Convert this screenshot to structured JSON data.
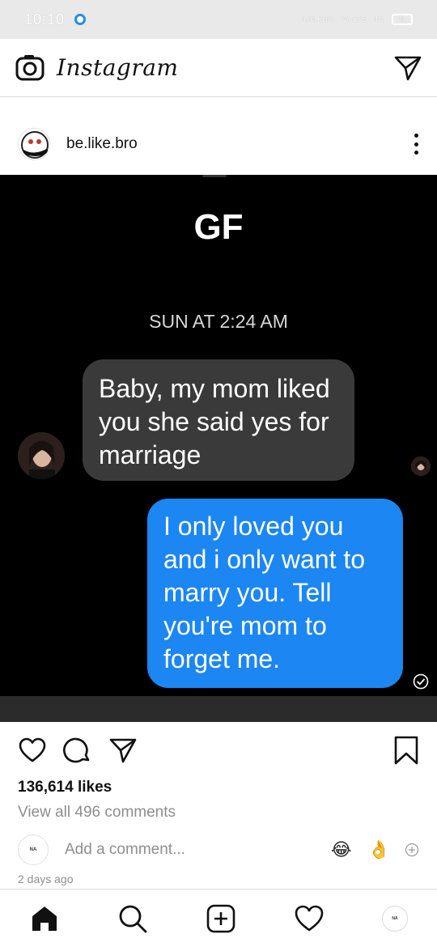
{
  "status_bar": {
    "time": "10:10",
    "speed": "3.00 KB/S",
    "network": "Vo LTE",
    "signal": "4G",
    "battery": "31"
  },
  "app_bar": {
    "brand": "Instagram",
    "camera_icon": "camera-icon",
    "direct_icon": "paper-plane-icon"
  },
  "post": {
    "username": "be.like.bro",
    "more_icon": "vertical-ellipsis-icon",
    "image": {
      "chat_title": "GF",
      "chat_time": "SUN AT 2:24 AM",
      "message_in": "Baby, my mom liked you she said yes for marriage",
      "message_out": "I only loved you and i only want to marry you. Tell you're mom to forget me.",
      "bubble_in_color": "#3a3a3a",
      "bubble_out_color": "#1c86f2"
    },
    "likes": "136,614 likes",
    "view_comments": "View all 496 comments",
    "add_comment_placeholder": "Add a comment...",
    "quick_emojis": [
      "😂",
      "👌"
    ],
    "date": "2 days ago"
  },
  "bottom_nav": {
    "items": [
      "home-icon",
      "search-icon",
      "add-post-icon",
      "activity-heart-icon",
      "profile-avatar"
    ]
  },
  "colors": {
    "text": "#262626",
    "secondary_text": "#8e8e8e",
    "divider": "#dbdbdb"
  }
}
